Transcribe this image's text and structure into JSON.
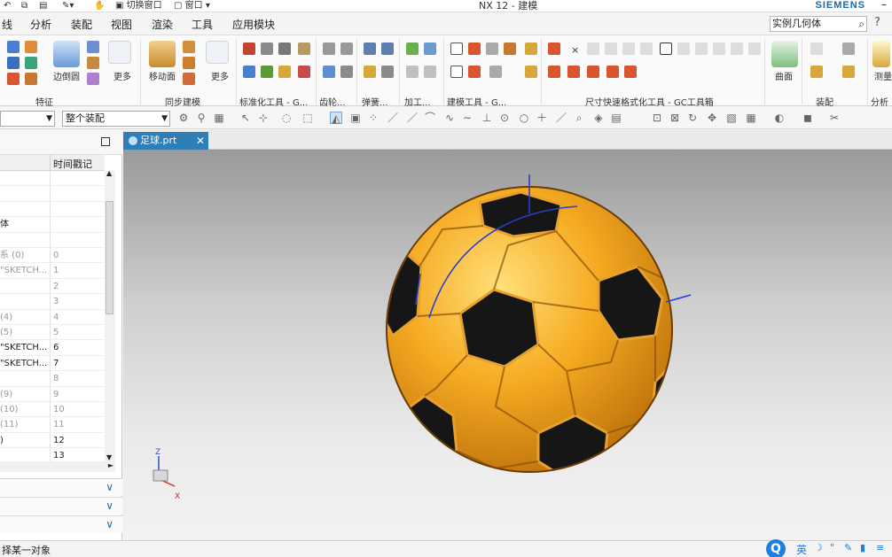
{
  "titlebar": {
    "window_title": "NX 12 - 建模",
    "brand": "SIEMENS",
    "switch_window": "切换窗口",
    "window_menu": "窗口"
  },
  "menu": {
    "items": [
      "线",
      "分析",
      "装配",
      "视图",
      "渲染",
      "工具",
      "应用模块"
    ],
    "search_value": "实例几何体"
  },
  "ribbon": {
    "labels": {
      "edge_blend": "边倒圆",
      "more1": "更多",
      "move_face": "移动面",
      "more2": "更多",
      "surface": "曲面",
      "measure": "测量"
    },
    "groups": [
      "特征",
      "同步建模",
      "标准化工具 - G...",
      "齿轮...",
      "弹簧...",
      "加工...",
      "建模工具 - G...",
      "尺寸快速格式化工具 - GC工具箱",
      "装配",
      "分析"
    ]
  },
  "toolbar": {
    "filter_value": "",
    "assembly_value": "整个装配"
  },
  "navigator": {
    "column_header": "时间戳记",
    "rows": [
      {
        "name": "",
        "stamp": "",
        "dim": false
      },
      {
        "name": "",
        "stamp": "",
        "dim": false
      },
      {
        "name": "",
        "stamp": "",
        "dim": false
      },
      {
        "name": "体",
        "stamp": "",
        "dim": false
      },
      {
        "name": "",
        "stamp": "",
        "dim": false
      },
      {
        "name": "系 (0)",
        "stamp": "0",
        "dim": true
      },
      {
        "name": "\"SKETCH...",
        "stamp": "1",
        "dim": true
      },
      {
        "name": "",
        "stamp": "2",
        "dim": true
      },
      {
        "name": "",
        "stamp": "3",
        "dim": true
      },
      {
        "name": "(4)",
        "stamp": "4",
        "dim": true
      },
      {
        "name": "(5)",
        "stamp": "5",
        "dim": true
      },
      {
        "name": "\"SKETCH...",
        "stamp": "6",
        "dim": false
      },
      {
        "name": "\"SKETCH...",
        "stamp": "7",
        "dim": false
      },
      {
        "name": "",
        "stamp": "8",
        "dim": true
      },
      {
        "name": "(9)",
        "stamp": "9",
        "dim": true
      },
      {
        "name": "(10)",
        "stamp": "10",
        "dim": true
      },
      {
        "name": "(11)",
        "stamp": "11",
        "dim": true
      },
      {
        "name": ")",
        "stamp": "12",
        "dim": false
      },
      {
        "name": "",
        "stamp": "13",
        "dim": false
      }
    ]
  },
  "viewport": {
    "tab_label": "足球.prt",
    "ball_color": "#f0a020",
    "patch_color": "#1a1a1a",
    "triad_labels": {
      "z": "Z",
      "x": "X"
    }
  },
  "status": {
    "prompt": "择某一对象",
    "ime_lang": "英"
  }
}
